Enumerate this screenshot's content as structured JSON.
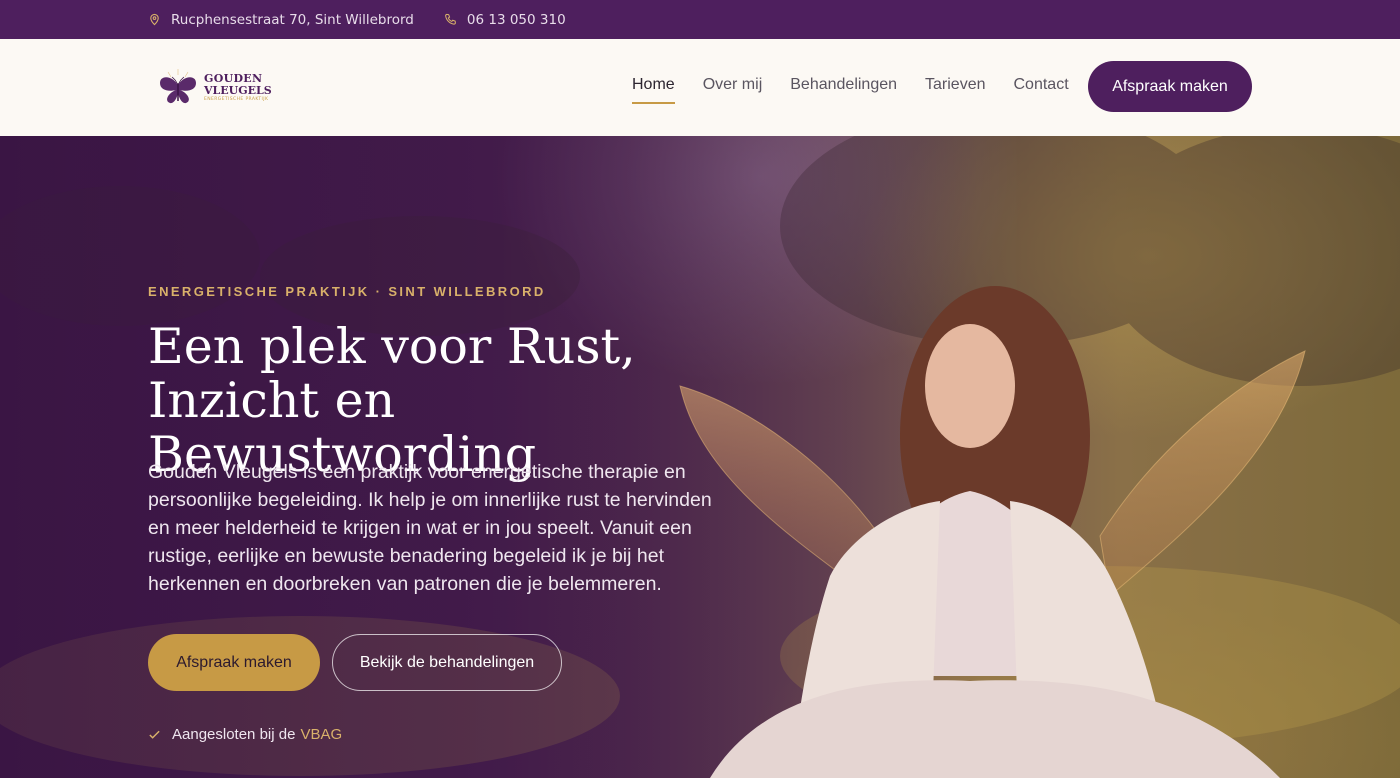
{
  "topbar": {
    "address": "Rucphensestraat 70, Sint Willebrord",
    "phone": "06 13 050 310",
    "address_icon": "location-pin-icon",
    "phone_icon": "phone-icon"
  },
  "brand": {
    "name_line1": "GOUDEN",
    "name_line2": "VLEUGELS",
    "tagline": "ENERGETISCHE PRAKTIJK",
    "logo_icon": "butterfly-icon"
  },
  "nav": {
    "items": [
      {
        "label": "Home",
        "active": true
      },
      {
        "label": "Over mij",
        "active": false
      },
      {
        "label": "Behandelingen",
        "active": false
      },
      {
        "label": "Tarieven",
        "active": false
      },
      {
        "label": "Contact",
        "active": false
      }
    ],
    "cta_label": "Afspraak maken"
  },
  "hero": {
    "eyebrow": "ENERGETISCHE PRAKTIJK · SINT WILLEBRORD",
    "headline": "Een plek voor Rust, Inzicht en Bewustwording",
    "intro": "Gouden Vleugels is een praktijk voor energetische therapie en persoonlijke begeleiding. Ik help je om innerlijke rust te hervinden en meer helderheid te krijgen in wat er in jou speelt. Vanuit een rustige, eerlijke en bewuste benadering begeleid ik je bij het herkennen en doorbreken van patronen die je belemmeren.",
    "primary_button": "Afspraak maken",
    "secondary_button": "Bekijk de behandelingen",
    "affiliation_text": "Aangesloten bij de",
    "affiliation_link": "VBAG",
    "affiliation_icon": "check-icon"
  },
  "colors": {
    "primary_purple": "#4e1f5e",
    "accent_gold": "#c79a45",
    "header_bg": "#fcf9f4"
  }
}
